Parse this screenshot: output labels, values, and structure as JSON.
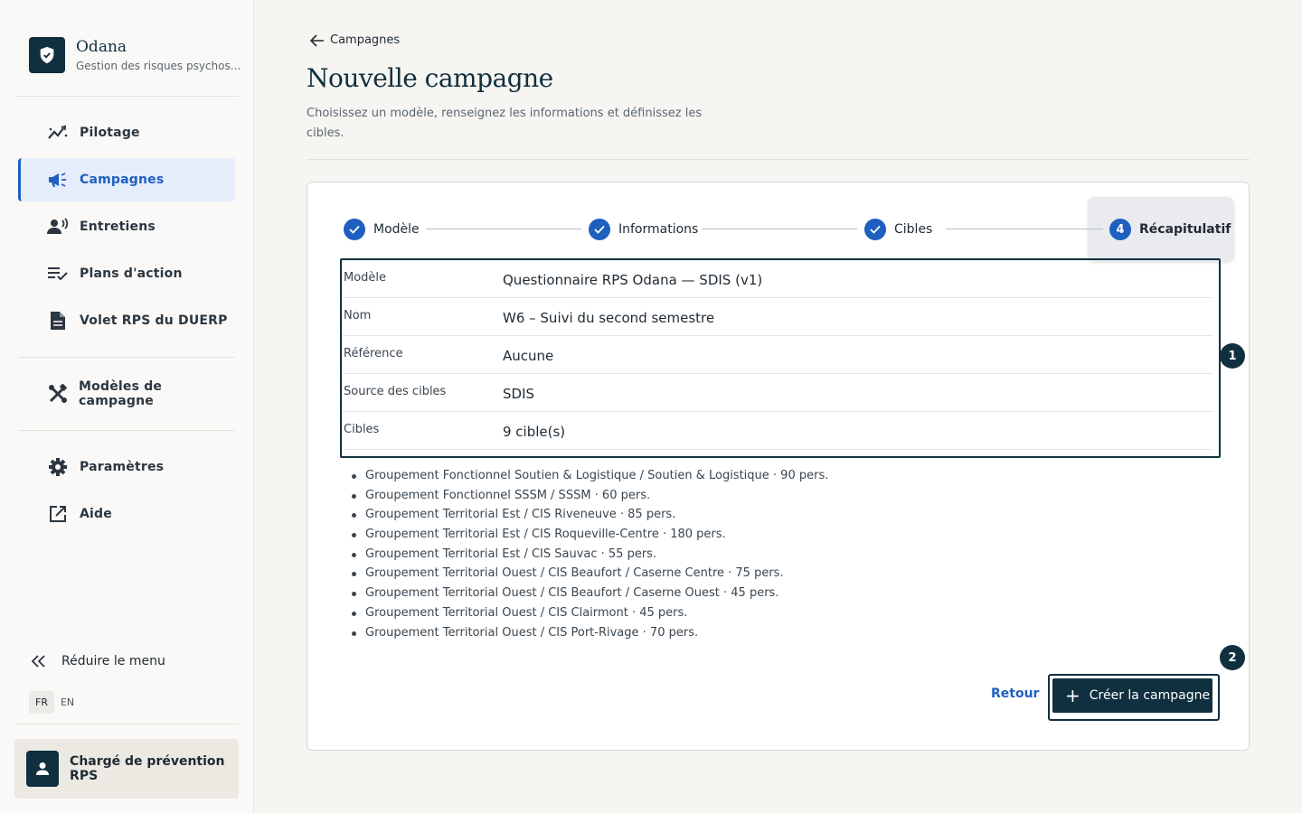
{
  "brand": {
    "name": "Odana",
    "subtitle": "Gestion des risques psychos..."
  },
  "nav": [
    {
      "label": "Pilotage",
      "icon": "chart-line-icon"
    },
    {
      "label": "Campagnes",
      "icon": "megaphone-icon",
      "active": true
    },
    {
      "label": "Entretiens",
      "icon": "speaking-person-icon"
    },
    {
      "label": "Plans d'action",
      "icon": "checklist-icon"
    },
    {
      "label": "Volet RPS du DUERP",
      "icon": "document-icon"
    },
    {
      "label": "Modèles de campagne",
      "icon": "tools-icon"
    },
    {
      "label": "Paramètres",
      "icon": "gear-icon"
    },
    {
      "label": "Aide",
      "icon": "external-link-icon"
    }
  ],
  "collapse_label": "Réduire le menu",
  "languages": [
    "FR",
    "EN"
  ],
  "selected_language": "FR",
  "user": {
    "role": "Chargé de prévention RPS"
  },
  "breadcrumb": {
    "back_label": "Campagnes"
  },
  "page": {
    "title": "Nouvelle campagne",
    "description": "Choisissez un modèle, renseignez les informations et définissez les cibles."
  },
  "steps": [
    {
      "label": "Modèle",
      "status": "done"
    },
    {
      "label": "Informations",
      "status": "done"
    },
    {
      "label": "Cibles",
      "status": "done"
    },
    {
      "label": "Récapitulatif",
      "number": "4",
      "status": "current"
    }
  ],
  "summary": [
    {
      "key": "Modèle",
      "value": "Questionnaire RPS Odana — SDIS (v1)"
    },
    {
      "key": "Nom",
      "value": "W6 – Suivi du second semestre"
    },
    {
      "key": "Référence",
      "value": "Aucune"
    },
    {
      "key": "Source des cibles",
      "value": "SDIS"
    },
    {
      "key": "Cibles",
      "value": "9 cible(s)"
    }
  ],
  "targets": [
    "Groupement Fonctionnel Soutien & Logistique / Soutien & Logistique · 90 pers.",
    "Groupement Fonctionnel SSSM / SSSM · 60 pers.",
    "Groupement Territorial Est / CIS Riveneuve · 85 pers.",
    "Groupement Territorial Est / CIS Roqueville-Centre · 180 pers.",
    "Groupement Territorial Est / CIS Sauvac · 55 pers.",
    "Groupement Territorial Ouest / CIS Beaufort / Caserne Centre · 75 pers.",
    "Groupement Territorial Ouest / CIS Beaufort / Caserne Ouest · 45 pers.",
    "Groupement Territorial Ouest / CIS Clairmont · 45 pers.",
    "Groupement Territorial Ouest / CIS Port-Rivage · 70 pers."
  ],
  "badges": [
    "1",
    "2"
  ],
  "actions": {
    "back_label": "Retour",
    "create_label": "Créer la campagne"
  },
  "colors": {
    "primary_dark": "#10303f",
    "accent_blue": "#1f5fbf",
    "active_nav_bg": "#e5edfb"
  }
}
